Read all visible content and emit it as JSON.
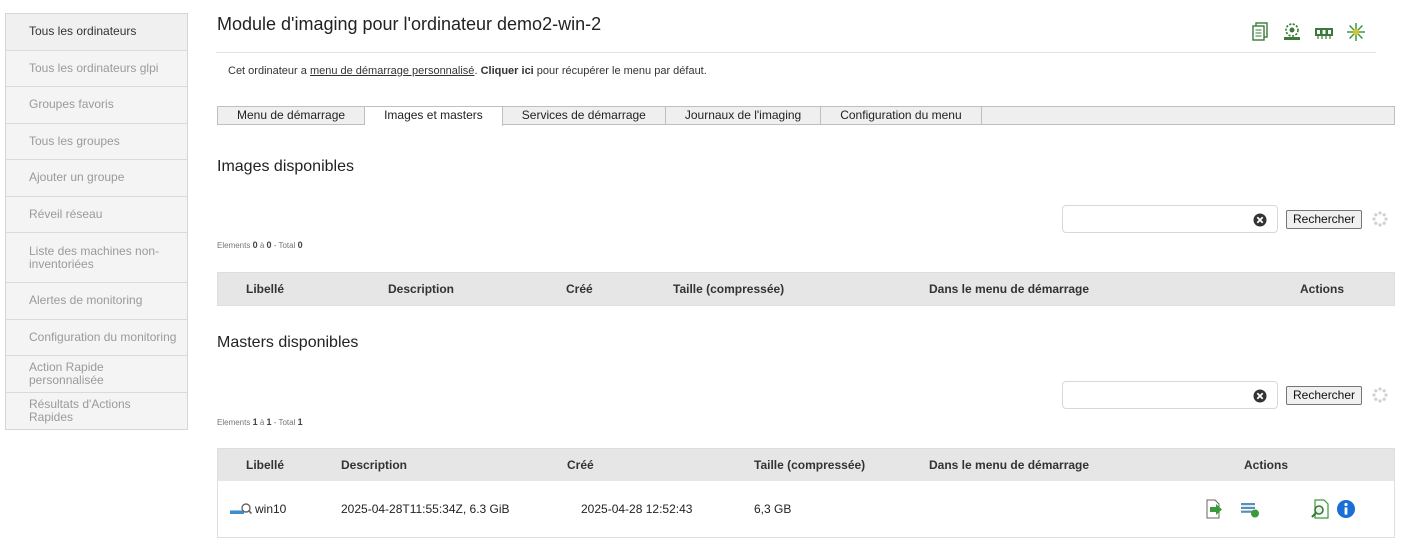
{
  "sidebar": {
    "items": [
      {
        "label": "Tous les ordinateurs"
      },
      {
        "label": "Tous les ordinateurs glpi"
      },
      {
        "label": "Groupes favoris"
      },
      {
        "label": "Tous les groupes"
      },
      {
        "label": "Ajouter un groupe"
      },
      {
        "label": "Réveil réseau"
      },
      {
        "label": "Liste des machines non-inventoriées"
      },
      {
        "label": "Alertes de monitoring"
      },
      {
        "label": "Configuration du monitoring"
      },
      {
        "label": "Action Rapide personnalisée"
      },
      {
        "label": "Résultats d'Actions Rapides"
      }
    ]
  },
  "page": {
    "title": "Module d'imaging pour l'ordinateur demo2-win-2",
    "header_icons": [
      "documents-icon",
      "network-settings-icon",
      "memory-icon",
      "imaging-spark-icon"
    ]
  },
  "notice": {
    "before": "Cet ordinateur a ",
    "link": "menu de démarrage personnalisé",
    "middle": ". ",
    "bold": "Cliquer ici",
    "after": " pour récupérer le menu par défaut."
  },
  "tabs": [
    {
      "label": "Menu de démarrage"
    },
    {
      "label": "Images et masters"
    },
    {
      "label": "Services de démarrage"
    },
    {
      "label": "Journaux de l'imaging"
    },
    {
      "label": "Configuration du menu"
    }
  ],
  "images": {
    "title": "Images disponibles",
    "search_button": "Rechercher",
    "search_value": "",
    "count_prefix": "Elements ",
    "count_from": "0",
    "count_sep": " à ",
    "count_to": "0",
    "count_total_label": " - Total ",
    "count_total": "0",
    "columns": [
      "Libellé",
      "Description",
      "Créé",
      "Taille (compressée)",
      "Dans le menu de démarrage",
      "Actions"
    ]
  },
  "masters": {
    "title": "Masters disponibles",
    "search_button": "Rechercher",
    "search_value": "",
    "count_prefix": "Elements ",
    "count_from": "1",
    "count_sep": " à ",
    "count_to": "1",
    "count_total_label": " - Total ",
    "count_total": "1",
    "columns": [
      "Libellé",
      "Description",
      "Créé",
      "Taille (compressée)",
      "Dans le menu de démarrage",
      "Actions"
    ],
    "rows": [
      {
        "label": "win10",
        "description": "2025-04-28T11:55:34Z, 6.3 GiB",
        "created": "2025-04-28 12:52:43",
        "size": "6,3 GB",
        "in_menu": ""
      }
    ]
  },
  "colors": {
    "accent_blue": "#1a6fd6",
    "icon_green": "#3a9b3a"
  }
}
